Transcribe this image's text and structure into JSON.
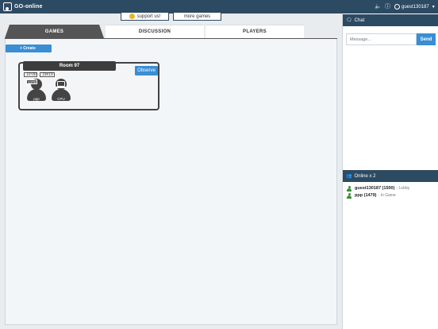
{
  "app": {
    "title": "GO-online"
  },
  "topbar": {
    "icons": [
      "volume-icon",
      "info-icon",
      "user-icon"
    ],
    "username": "guest130187"
  },
  "banner": {
    "support_label": "support us!",
    "more_label": "more games"
  },
  "tabs": [
    {
      "label": "GAMES",
      "active": true
    },
    {
      "label": "DISCUSSION",
      "active": false
    },
    {
      "label": "PLAYERS",
      "active": false
    }
  ],
  "games": {
    "create_label": "+ Create",
    "rooms": [
      {
        "title": "Room 97",
        "time": "10:00",
        "board_size": "19x19",
        "observe_label": "Observe",
        "players": [
          {
            "name": "ppp",
            "rating": "1479",
            "type": "human"
          },
          {
            "name": "CPU",
            "type": "computer"
          }
        ]
      }
    ]
  },
  "chat": {
    "title": "Chat",
    "placeholder": "Message...",
    "send_label": "Send"
  },
  "online": {
    "title": "Online x 2",
    "users": [
      {
        "name": "guest130187 (1500)",
        "status": "- Lobby"
      },
      {
        "name": "ppp (1479)",
        "status": "- In Game"
      }
    ]
  },
  "colors": {
    "navbar": "#2d4a63",
    "accent": "#3a8ed4",
    "online_green": "#3a8f3a",
    "dark": "#444444"
  }
}
